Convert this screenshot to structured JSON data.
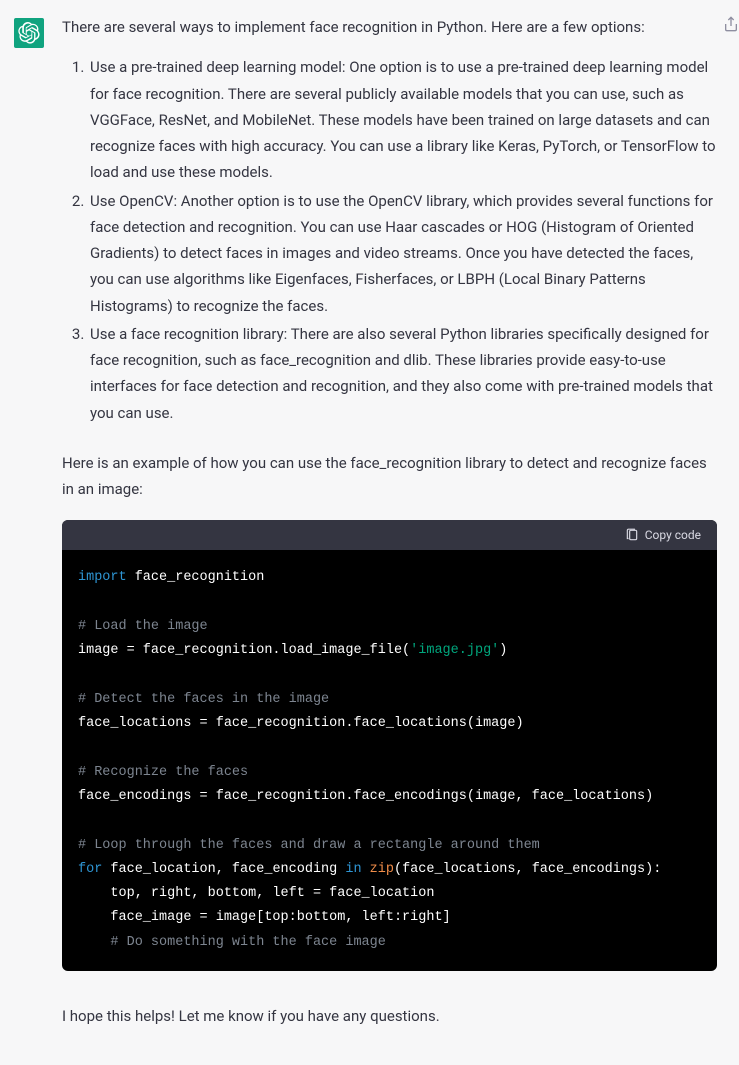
{
  "message": {
    "intro": "There are several ways to implement face recognition in Python. Here are a few options:",
    "list": [
      "Use a pre-trained deep learning model: One option is to use a pre-trained deep learning model for face recognition. There are several publicly available models that you can use, such as VGGFace, ResNet, and MobileNet. These models have been trained on large datasets and can recognize faces with high accuracy. You can use a library like Keras, PyTorch, or TensorFlow to load and use these models.",
      "Use OpenCV: Another option is to use the OpenCV library, which provides several functions for face detection and recognition. You can use Haar cascades or HOG (Histogram of Oriented Gradients) to detect faces in images and video streams. Once you have detected the faces, you can use algorithms like Eigenfaces, Fisherfaces, or LBPH (Local Binary Patterns Histograms) to recognize the faces.",
      "Use a face recognition library: There are also several Python libraries specifically designed for face recognition, such as face_recognition and dlib. These libraries provide easy-to-use interfaces for face detection and recognition, and they also come with pre-trained models that you can use."
    ],
    "subIntro": "Here is an example of how you can use the face_recognition library to detect and recognize faces in an image:",
    "copyLabel": "Copy code",
    "code": {
      "kw_import": "import",
      "mod": " face_recognition",
      "c1": "# Load the image",
      "l1a": "image = face_recognition.load_image_file(",
      "l1s": "'image.jpg'",
      "l1b": ")",
      "c2": "# Detect the faces in the image",
      "l2": "face_locations = face_recognition.face_locations(image)",
      "c3": "# Recognize the faces",
      "l3": "face_encodings = face_recognition.face_encodings(image, face_locations)",
      "c4": "# Loop through the faces and draw a rectangle around them",
      "kw_for": "for",
      "l4a": " face_location, face_encoding ",
      "kw_in": "in",
      "fn_zip": "zip",
      "l4b": "(face_locations, face_encodings):",
      "l5": "    top, right, bottom, left = face_location",
      "l6": "    face_image = image[top:bottom, left:right]",
      "c5": "    # Do something with the face image"
    },
    "closing": "I hope this helps! Let me know if you have any questions."
  }
}
